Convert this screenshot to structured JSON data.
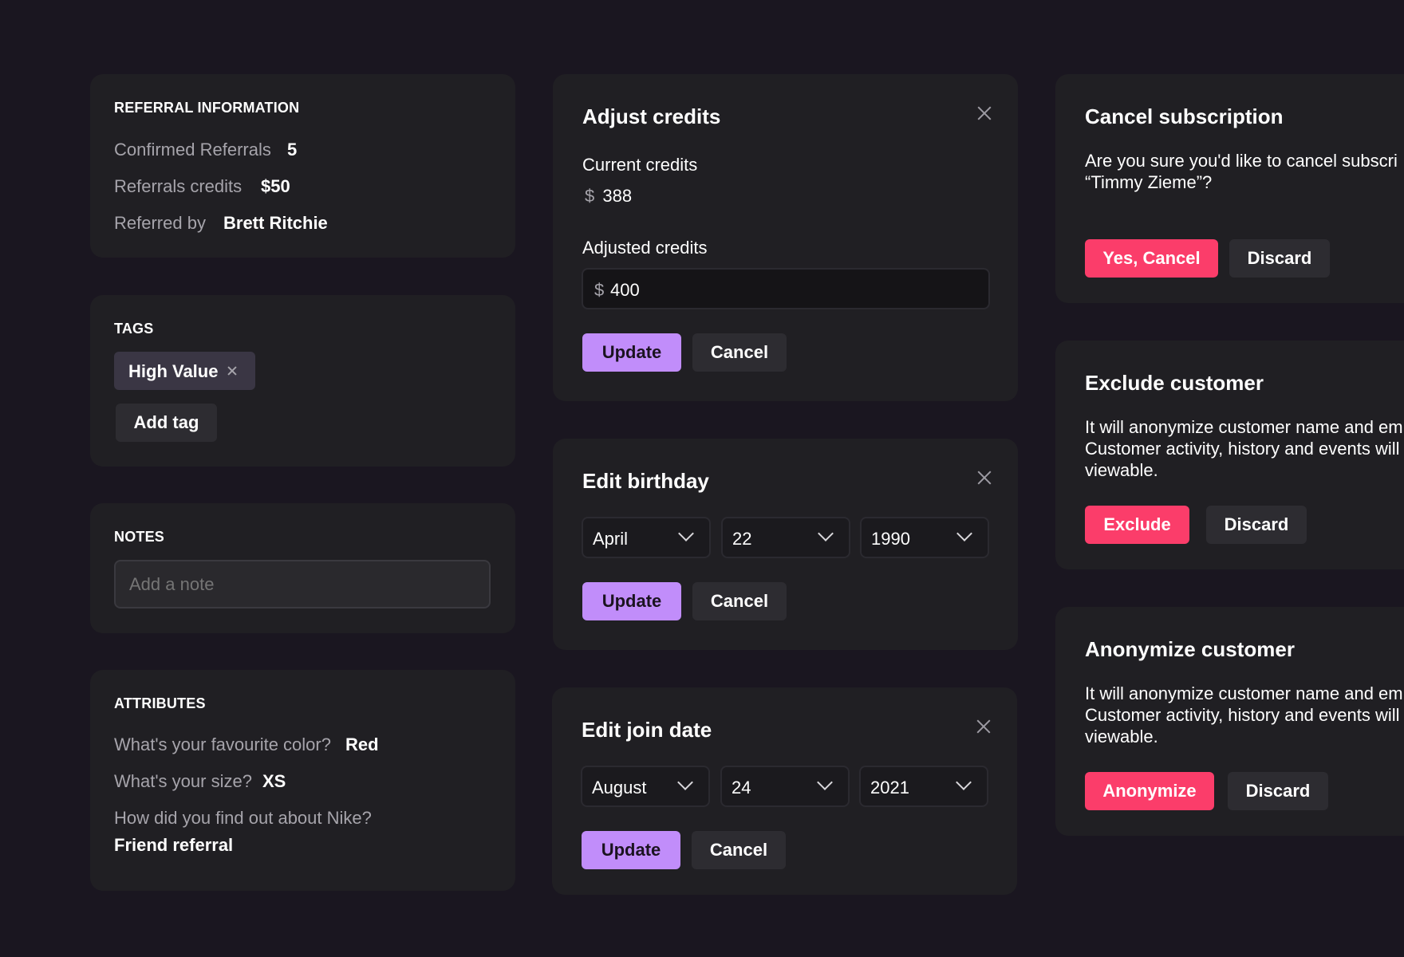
{
  "referral": {
    "title": "REFERRAL INFORMATION",
    "confirmed_label": "Confirmed Referrals",
    "confirmed_value": "5",
    "credits_label": "Referrals credits",
    "credits_value": "$50",
    "referred_label": "Referred by",
    "referred_value": "Brett Ritchie"
  },
  "tags": {
    "title": "TAGS",
    "items": [
      {
        "label": "High Value"
      }
    ],
    "add_label": "Add tag"
  },
  "notes": {
    "title": "NOTES",
    "placeholder": "Add a note"
  },
  "attributes": {
    "title": "ATTRIBUTES",
    "items": [
      {
        "question": "What's your favourite color?",
        "answer": "Red"
      },
      {
        "question": "What's your size?",
        "answer": "XS"
      },
      {
        "question": "How did you find out about Nike?",
        "answer": "Friend referral"
      }
    ]
  },
  "adjust_credits": {
    "title": "Adjust credits",
    "current_label": "Current credits",
    "currency": "$",
    "current_value": "388",
    "adjusted_label": "Adjusted credits",
    "adjusted_value": "400",
    "update_label": "Update",
    "cancel_label": "Cancel"
  },
  "edit_birthday": {
    "title": "Edit birthday",
    "month": "April",
    "day": "22",
    "year": "1990",
    "update_label": "Update",
    "cancel_label": "Cancel"
  },
  "edit_join_date": {
    "title": "Edit join date",
    "month": "August",
    "day": "24",
    "year": "2021",
    "update_label": "Update",
    "cancel_label": "Cancel"
  },
  "cancel_subscription": {
    "title": "Cancel subscription",
    "body": "Are you sure you'd like to cancel subscri\n“Timmy Zieme”?",
    "confirm_label": "Yes, Cancel",
    "discard_label": "Discard"
  },
  "exclude_customer": {
    "title": "Exclude customer",
    "body": "It will anonymize customer name and em\nCustomer activity, history and events will\nviewable.",
    "confirm_label": "Exclude",
    "discard_label": "Discard"
  },
  "anonymize_customer": {
    "title": "Anonymize customer",
    "body": "It will anonymize customer name and em\nCustomer activity, history and events will\nviewable.",
    "confirm_label": "Anonymize",
    "discard_label": "Discard"
  },
  "colors": {
    "background": "#1a1620",
    "card": "#201f23",
    "primary": "#c18dfa",
    "danger": "#fb3d6a",
    "secondary": "#2d2c31"
  },
  "icons": [
    "close-icon",
    "chevron-down-icon",
    "remove-tag-icon"
  ]
}
